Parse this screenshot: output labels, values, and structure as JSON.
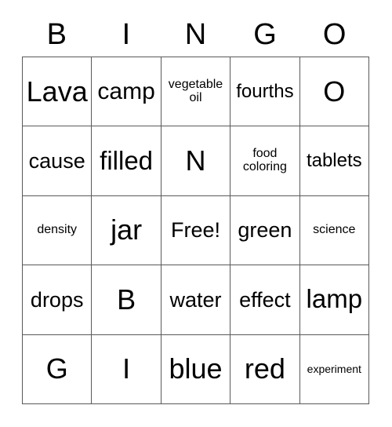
{
  "card": {
    "title": "BINGO",
    "header_letters": [
      "B",
      "I",
      "N",
      "G",
      "O"
    ],
    "grid": {
      "columns": 5,
      "rows": 5,
      "free_space": "Free!",
      "border_color": "#595959",
      "text_color": "#000000",
      "background_color": "#ffffff"
    },
    "cells": [
      {
        "text": "Lava",
        "size": "fs-xxl"
      },
      {
        "text": "camp",
        "size": "fs-lg"
      },
      {
        "text": "vegetable oil",
        "size": "fs-xs"
      },
      {
        "text": "fourths",
        "size": "fs-sm"
      },
      {
        "text": "O",
        "size": "fs-xxl"
      },
      {
        "text": "cause",
        "size": "fs-md"
      },
      {
        "text": "filled",
        "size": "fs-xl"
      },
      {
        "text": "N",
        "size": "fs-xxl"
      },
      {
        "text": "food coloring",
        "size": "fs-xs"
      },
      {
        "text": "tablets",
        "size": "fs-sm"
      },
      {
        "text": "density",
        "size": "fs-xs"
      },
      {
        "text": "jar",
        "size": "fs-xxl"
      },
      {
        "text": "Free!",
        "size": "fs-md"
      },
      {
        "text": "green",
        "size": "fs-md"
      },
      {
        "text": "science",
        "size": "fs-xs"
      },
      {
        "text": "drops",
        "size": "fs-md"
      },
      {
        "text": "B",
        "size": "fs-xxl"
      },
      {
        "text": "water",
        "size": "fs-md"
      },
      {
        "text": "effect",
        "size": "fs-md"
      },
      {
        "text": "lamp",
        "size": "fs-xl"
      },
      {
        "text": "G",
        "size": "fs-xxl"
      },
      {
        "text": "I",
        "size": "fs-xxl"
      },
      {
        "text": "blue",
        "size": "fs-xxl"
      },
      {
        "text": "red",
        "size": "fs-xxl"
      },
      {
        "text": "experiment",
        "size": "fs-xxs"
      }
    ]
  }
}
